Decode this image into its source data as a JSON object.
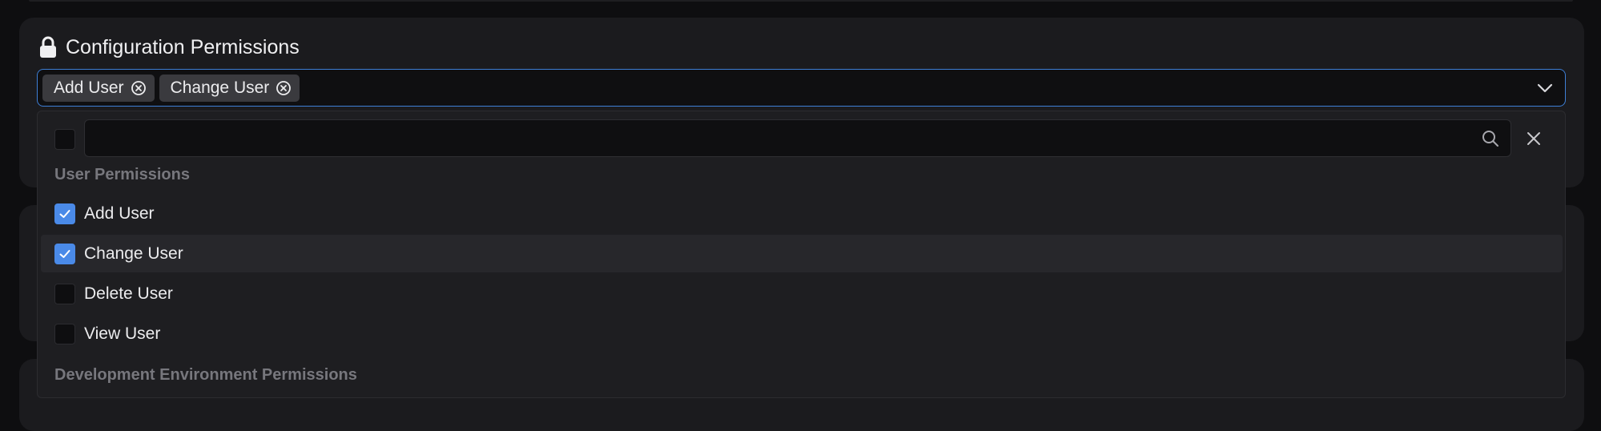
{
  "section": {
    "title": "Configuration Permissions",
    "icon": "lock-icon"
  },
  "selected_tags": [
    {
      "label": "Add User"
    },
    {
      "label": "Change User"
    }
  ],
  "search": {
    "value": "",
    "placeholder": ""
  },
  "groups": [
    {
      "label": "User Permissions",
      "options": [
        {
          "label": "Add User",
          "checked": true
        },
        {
          "label": "Change User",
          "checked": true
        },
        {
          "label": "Delete User",
          "checked": false
        },
        {
          "label": "View User",
          "checked": false
        }
      ]
    },
    {
      "label": "Development Environment Permissions",
      "options": []
    }
  ],
  "colors": {
    "accent": "#4a8ae8",
    "focus_border": "#3e7fd6",
    "background": "#0e0e10",
    "card": "#1b1b1e"
  }
}
